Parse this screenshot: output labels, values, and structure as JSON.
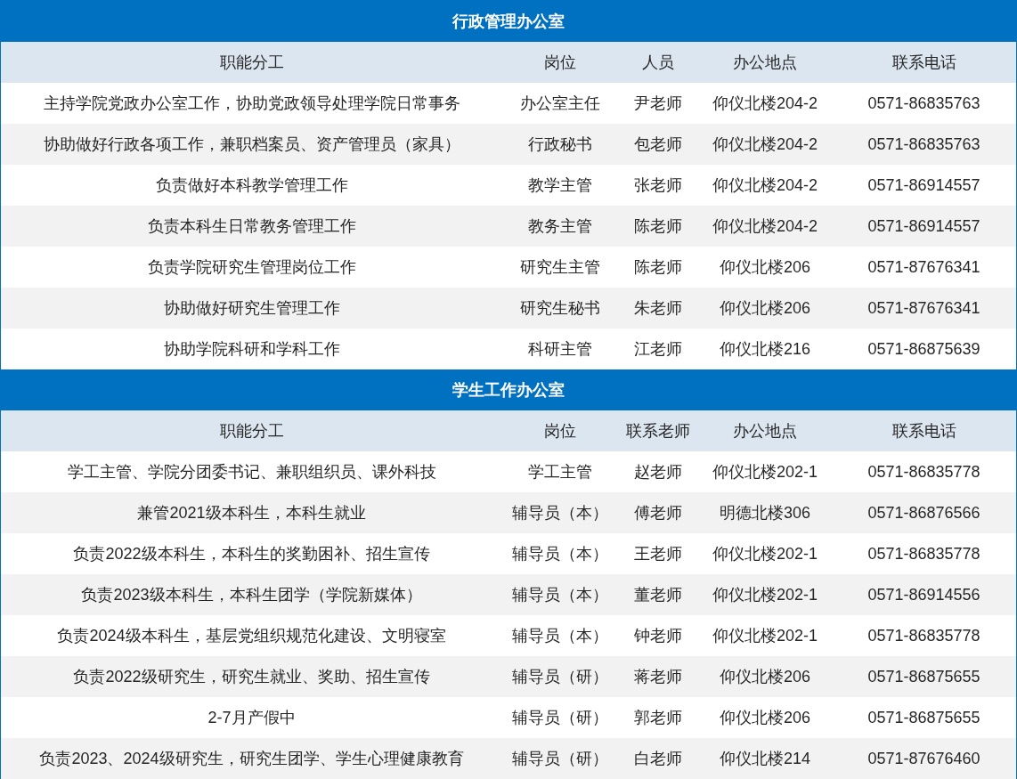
{
  "sections": [
    {
      "title": "行政管理办公室",
      "columns": [
        "职能分工",
        "岗位",
        "人员",
        "办公地点",
        "联系电话"
      ],
      "rows": [
        [
          "主持学院党政办公室工作，协助党政领导处理学院日常事务",
          "办公室主任",
          "尹老师",
          "仰仪北楼204-2",
          "0571-86835763"
        ],
        [
          "协助做好行政各项工作，兼职档案员、资产管理员（家具）",
          "行政秘书",
          "包老师",
          "仰仪北楼204-2",
          "0571-86835763"
        ],
        [
          "负责做好本科教学管理工作",
          "教学主管",
          "张老师",
          "仰仪北楼204-2",
          "0571-86914557"
        ],
        [
          "负责本科生日常教务管理工作",
          "教务主管",
          "陈老师",
          "仰仪北楼204-2",
          "0571-86914557"
        ],
        [
          "负责学院研究生管理岗位工作",
          "研究生主管",
          "陈老师",
          "仰仪北楼206",
          "0571-87676341"
        ],
        [
          "协助做好研究生管理工作",
          "研究生秘书",
          "朱老师",
          "仰仪北楼206",
          "0571-87676341"
        ],
        [
          "协助学院科研和学科工作",
          "科研主管",
          "江老师",
          "仰仪北楼216",
          "0571-86875639"
        ]
      ]
    },
    {
      "title": "学生工作办公室",
      "columns": [
        "职能分工",
        "岗位",
        "联系老师",
        "办公地点",
        "联系电话"
      ],
      "rows": [
        [
          "学工主管、学院分团委书记、兼职组织员、课外科技",
          "学工主管",
          "赵老师",
          "仰仪北楼202-1",
          "0571-86835778"
        ],
        [
          "兼管2021级本科生，本科生就业",
          "辅导员（本）",
          "傅老师",
          "明德北楼306",
          "0571-86876566"
        ],
        [
          "负责2022级本科生，本科生的奖勤困补、招生宣传",
          "辅导员（本）",
          "王老师",
          "仰仪北楼202-1",
          "0571-86835778"
        ],
        [
          "负责2023级本科生，本科生团学（学院新媒体）",
          "辅导员（本）",
          "董老师",
          "仰仪北楼202-1",
          "0571-86914556"
        ],
        [
          "负责2024级本科生，基层党组织规范化建设、文明寝室",
          "辅导员（本）",
          "钟老师",
          "仰仪北楼202-1",
          "0571-86835778"
        ],
        [
          "负责2022级研究生，研究生就业、奖助、招生宣传",
          "辅导员（研）",
          "蒋老师",
          "仰仪北楼206",
          "0571-86875655"
        ],
        [
          "2-7月产假中",
          "辅导员（研）",
          "郭老师",
          "仰仪北楼206",
          "0571-86875655"
        ],
        [
          "负责2023、2024级研究生，研究生团学、学生心理健康教育",
          "辅导员（研）",
          "白老师",
          "仰仪北楼214",
          "0571-87676460"
        ]
      ]
    }
  ]
}
